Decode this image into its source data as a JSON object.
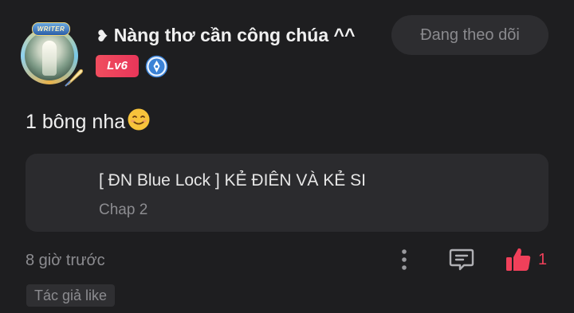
{
  "comment": {
    "author": {
      "name": "Nàng thơ cần công chúa ^^",
      "heart_glyph": "❥",
      "avatar_badge": "WRITER",
      "level": "Lv6",
      "accent": "#e8365a"
    },
    "follow_label": "Đang theo dõi",
    "text": "1 bông nha",
    "emoji": "smiling-face-icon",
    "story": {
      "title": "[ ĐN Blue Lock ] KẺ ĐIÊN VÀ KẺ SI",
      "chapter": "Chap 2"
    },
    "time": "8 giờ trước",
    "like_count": "1",
    "author_liked_label": "Tác giả like"
  },
  "colors": {
    "background": "#1e1e20",
    "card": "#2b2b2e",
    "like": "#f0405a",
    "muted": "#8c8c90"
  }
}
